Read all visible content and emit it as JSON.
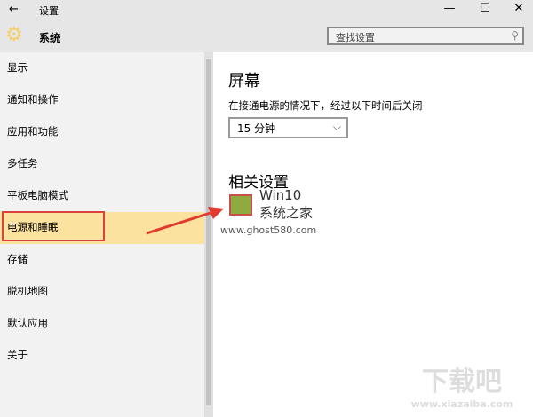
{
  "titlebar": {
    "title": "设置",
    "back": "←",
    "minimize": "—",
    "maximize": "☐",
    "close": "✕"
  },
  "header": {
    "section": "系统",
    "search_placeholder": "查找设置"
  },
  "sidebar": {
    "items": [
      "显示",
      "通知和操作",
      "应用和功能",
      "多任务",
      "平板电脑模式",
      "电源和睡眠",
      "存储",
      "脱机地图",
      "默认应用",
      "关于"
    ],
    "selected": 5
  },
  "main": {
    "heading": "屏幕",
    "description": "在接通电源的情况下，经过以下时间后关闭",
    "timeout": "15 分钟",
    "related": "相关设置"
  },
  "overlay": {
    "logo_line1": "Win10",
    "logo_line2": "系统之家",
    "logo_url": "www.ghost580.com",
    "watermark": "下载吧",
    "watermark_url": "www.xiazaiba.com"
  },
  "colors": {
    "accent": "#f5cf6a",
    "selected": "#fbe29f",
    "highlight": "#d9413a"
  }
}
